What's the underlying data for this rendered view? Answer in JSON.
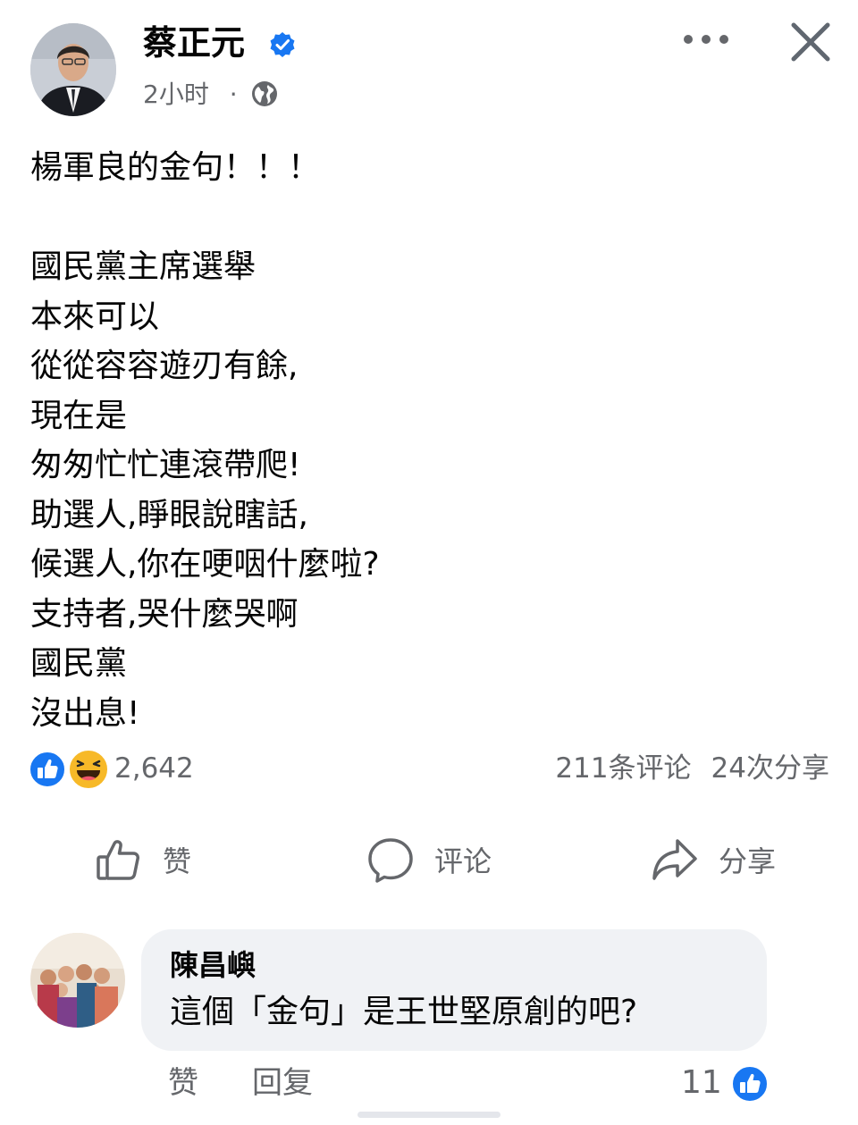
{
  "post": {
    "author": "蔡正元",
    "time": "2小时",
    "separator": "·",
    "text": "楊軍良的金句！！！\n\n國民黨主席選舉\n本來可以\n從從容容遊刃有餘,\n現在是\n匆匆忙忙連滾帶爬!\n助選人,睜眼說瞎話,\n候選人,你在哽咽什麼啦?\n支持者,哭什麼哭啊\n國民黨\n沒出息!",
    "reaction_count": "2,642",
    "comment_count": "211条评论",
    "share_count": "24次分享"
  },
  "actions": {
    "like": "赞",
    "comment": "评论",
    "share": "分享"
  },
  "comment": {
    "author": "陳昌嶼",
    "text": "這個「金句」是王世堅原創的吧?",
    "like_label": "赞",
    "reply_label": "回复",
    "like_count": "11"
  },
  "colors": {
    "brand_blue": "#1877f2",
    "secondary_text": "#65676b",
    "bubble_bg": "#f0f2f5"
  },
  "icons": [
    "verified-badge-icon",
    "globe-icon",
    "more-icon",
    "close-icon",
    "like-reaction-icon",
    "haha-reaction-icon",
    "thumbs-up-icon",
    "comment-bubble-icon",
    "share-arrow-icon"
  ]
}
